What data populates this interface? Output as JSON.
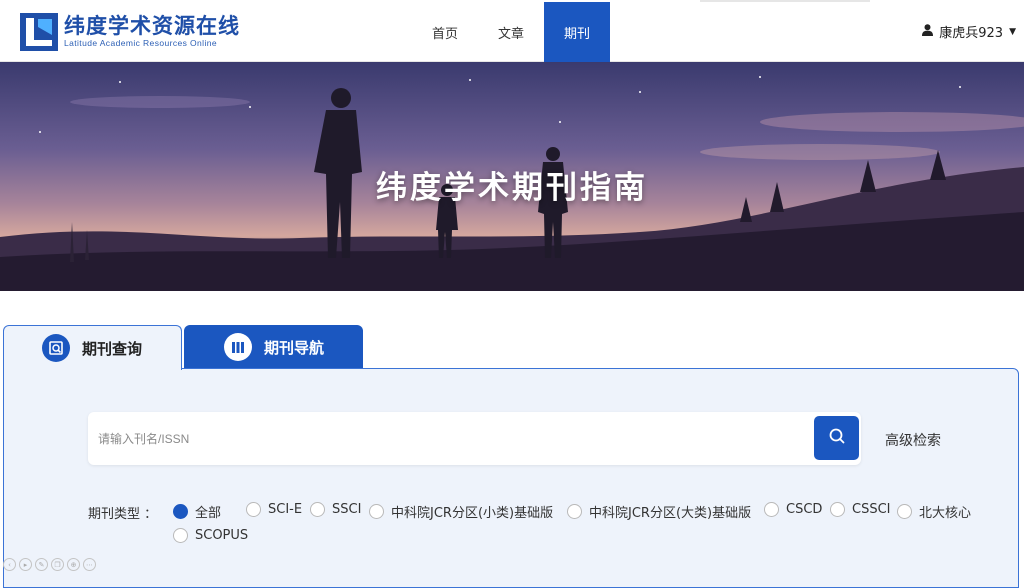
{
  "header": {
    "logo_cn": "纬度学术资源在线",
    "logo_en": "Latitude Academic Resources Online",
    "nav": [
      {
        "label": "首页",
        "active": false
      },
      {
        "label": "文章",
        "active": false
      },
      {
        "label": "期刊",
        "active": true
      }
    ],
    "user_name": "康虎兵923",
    "user_icon": "user-icon",
    "caret_icon": "caret-down-icon"
  },
  "banner": {
    "title": "纬度学术期刊指南"
  },
  "tabs": {
    "query_label": "期刊查询",
    "query_icon": "search-doc-icon",
    "nav_label": "期刊导航",
    "nav_icon": "books-icon"
  },
  "search": {
    "placeholder": "请输入刊名/ISSN",
    "value": "",
    "button_icon": "search-icon",
    "advanced_label": "高级检索"
  },
  "filter": {
    "label": "期刊类型 ：",
    "options": [
      {
        "label": "全部",
        "checked": true
      },
      {
        "label": "SCI-E",
        "checked": false
      },
      {
        "label": "SSCI",
        "checked": false
      },
      {
        "label": "中科院JCR分区(小类)基础版",
        "checked": false
      },
      {
        "label": "中科院JCR分区(大类)基础版",
        "checked": false
      },
      {
        "label": "CSCD",
        "checked": false
      },
      {
        "label": "CSSCI",
        "checked": false
      },
      {
        "label": "北大核心",
        "checked": false
      },
      {
        "label": "SCOPUS",
        "checked": false
      }
    ]
  },
  "colors": {
    "primary": "#1b57c0",
    "panel_bg": "#eef3fb",
    "border": "#3b73d6"
  }
}
